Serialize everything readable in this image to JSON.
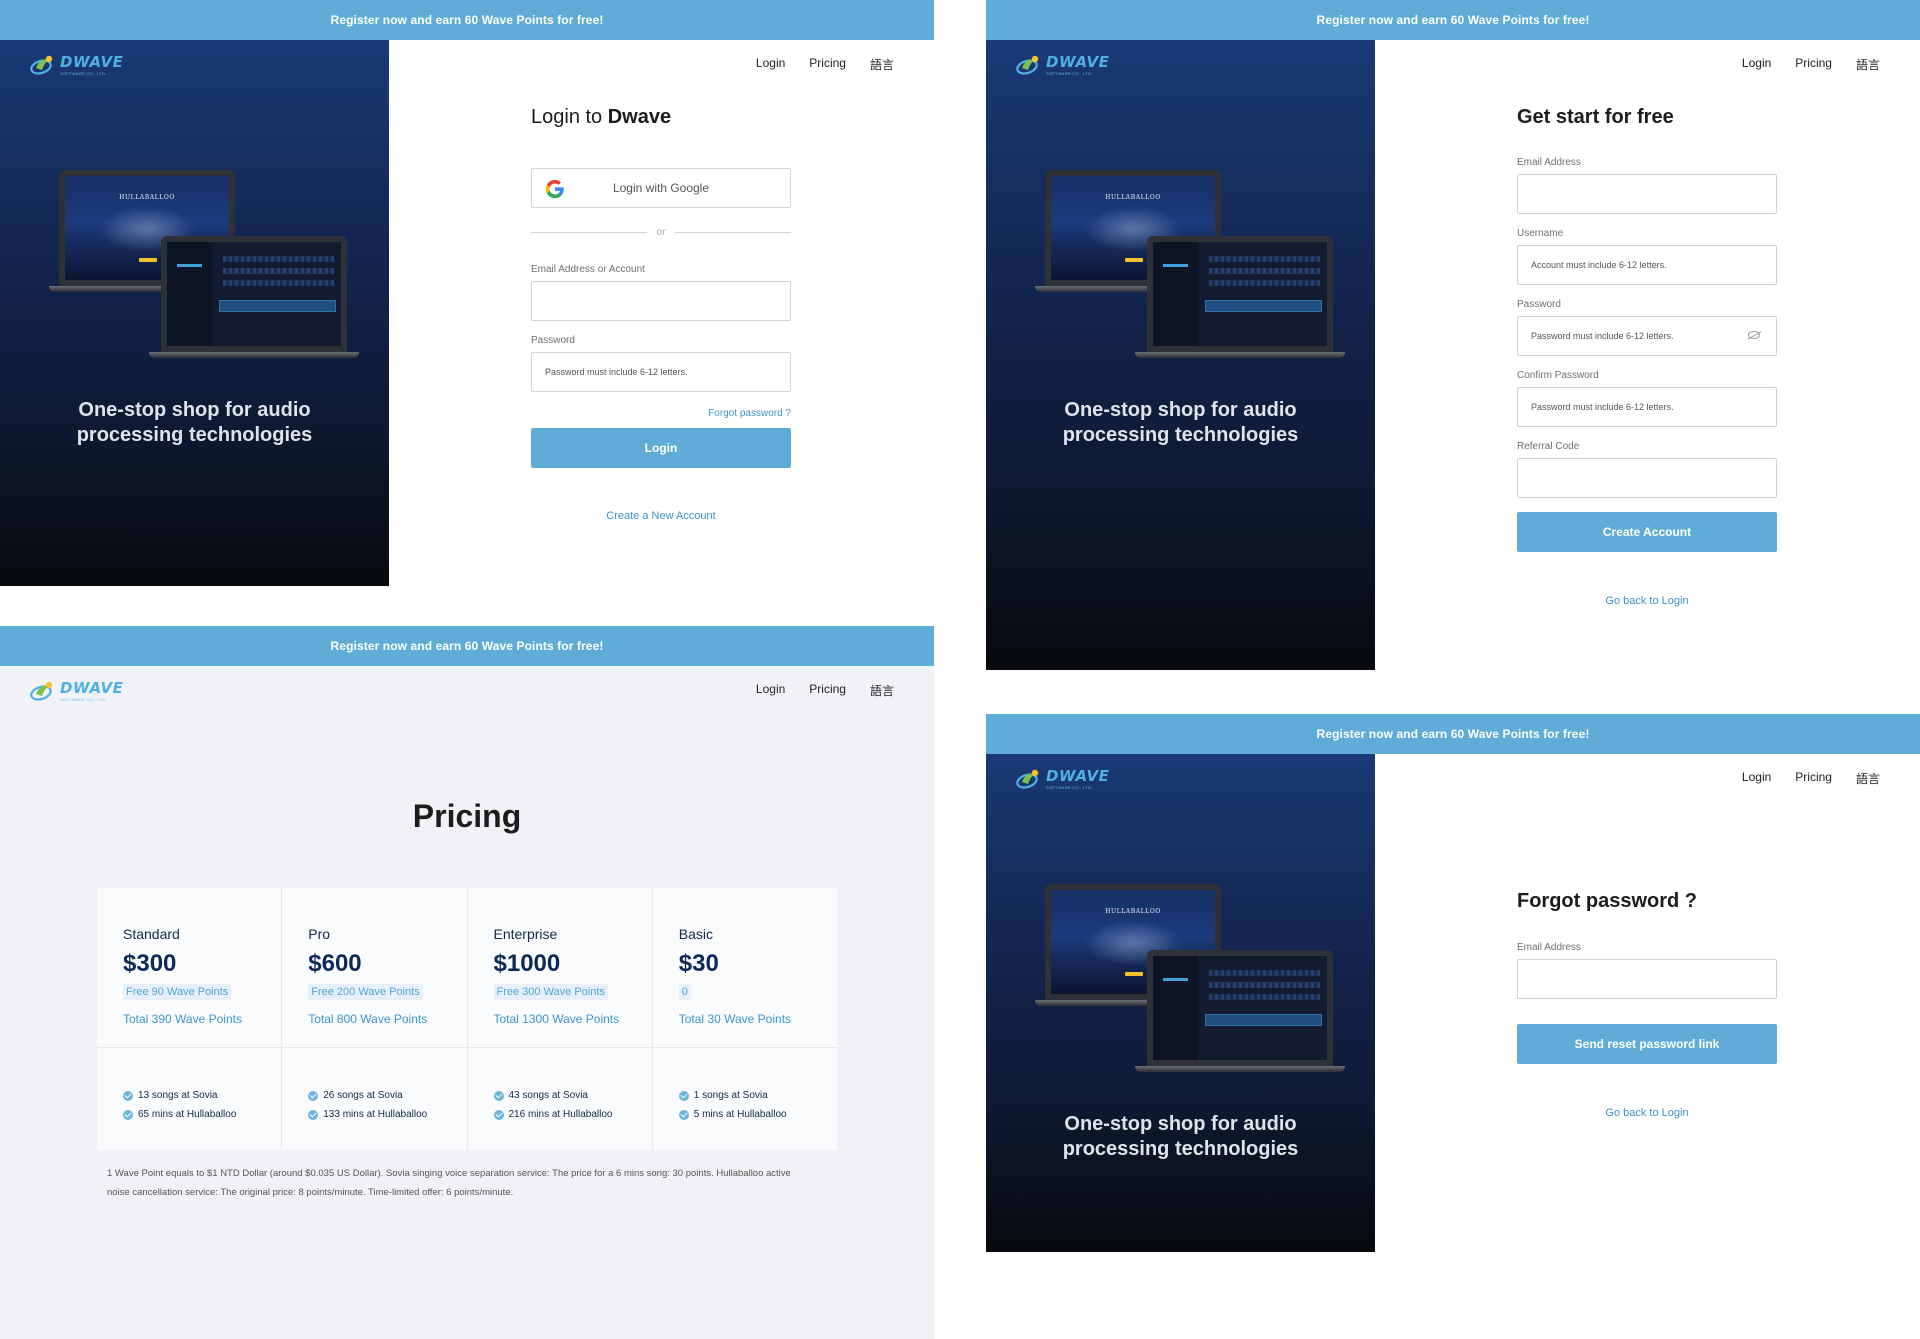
{
  "banner": "Register now and earn 60 Wave Points for free!",
  "nav": {
    "login": "Login",
    "pricing": "Pricing",
    "language": "語言"
  },
  "brand": {
    "name": "DWAVE",
    "sub": "SOFTWARE CO., LTD."
  },
  "tagline": {
    "line1": "One-stop shop for audio",
    "line2": "processing technologies"
  },
  "mockup": {
    "app_title": "HULLABALLOO"
  },
  "login": {
    "title_prefix": "Login to ",
    "title_brand": "Dwave",
    "google_button": "Login with Google",
    "or": "or",
    "email_label": "Email Address or Account",
    "password_label": "Password",
    "password_placeholder": "Password must include 6-12 letters.",
    "forgot_link": "Forgot password ?",
    "login_button": "Login",
    "create_link": "Create a New Account"
  },
  "signup": {
    "title": "Get start for free",
    "email_label": "Email Address",
    "username_label": "Username",
    "username_placeholder": "Account must include 6-12 letters.",
    "password_label": "Password",
    "password_placeholder": "Password must include 6-12 letters.",
    "confirm_label": "Confirm Password",
    "confirm_placeholder": "Password must include 6-12 letters.",
    "referral_label": "Referral Code",
    "create_button": "Create Account",
    "back_link": "Go back to Login"
  },
  "forgot": {
    "title": "Forgot password ?",
    "email_label": "Email Address",
    "send_button": "Send reset password link",
    "back_link": "Go back to Login"
  },
  "pricing": {
    "title": "Pricing",
    "plans": [
      {
        "name": "Standard",
        "price": "$300",
        "free": "Free 90 Wave Points",
        "total": "Total 390 Wave Points",
        "f1": "13 songs at Sovia",
        "f2": "65 mins at Hullaballoo"
      },
      {
        "name": "Pro",
        "price": "$600",
        "free": "Free 200 Wave Points",
        "total": "Total 800 Wave Points",
        "f1": "26 songs at Sovia",
        "f2": "133 mins at Hullaballoo"
      },
      {
        "name": "Enterprise",
        "price": "$1000",
        "free": "Free 300 Wave Points",
        "total": "Total 1300 Wave Points",
        "f1": "43 songs at Sovia",
        "f2": "216 mins at Hullaballoo"
      },
      {
        "name": "Basic",
        "price": "$30",
        "free": "0",
        "total": "Total 30 Wave Points",
        "f1": "1 songs at Sovia",
        "f2": "5 mins at Hullaballoo"
      }
    ],
    "footnote_line1": "1 Wave Point equals to $1 NTD Dollar (around $0.035 US Dollar). Sovia singing voice separation service: The price for a 6 mins song: 30 points. Hullaballoo active",
    "footnote_line2": "noise cancellation service: The original price: 8 points/minute. Time-limited offer: 6 points/minute."
  },
  "colors": {
    "banner": "#5fadd6",
    "primary_button": "#5fadd6",
    "link": "#3c93c7",
    "sidebar_top": "#1a3a74",
    "sidebar_bottom": "#07090d",
    "pricing_bg": "#f1f2f5"
  }
}
